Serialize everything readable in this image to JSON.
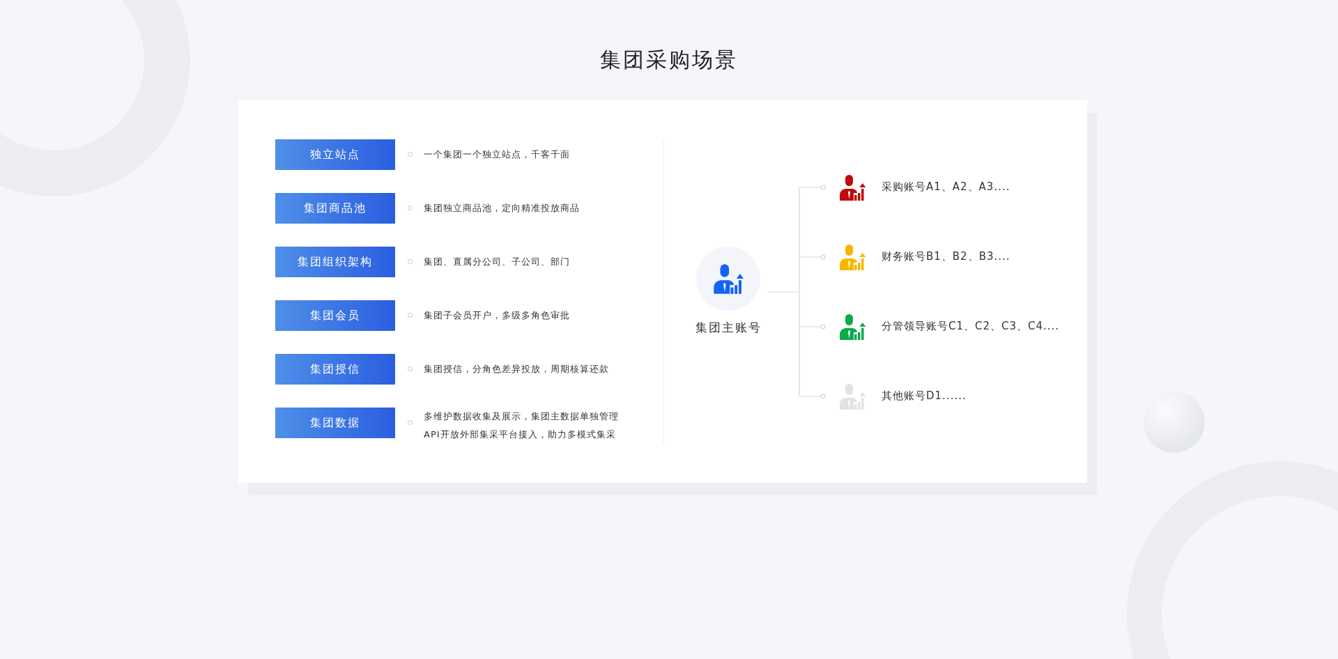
{
  "title": "集团采购场景",
  "features": [
    {
      "label": "独立站点",
      "description": [
        "一个集团一个独立站点，千客千面"
      ]
    },
    {
      "label": "集团商品池",
      "description": [
        "集团独立商品池，定向精准投放商品"
      ]
    },
    {
      "label": "集团组织架构",
      "description": [
        "集团、直属分公司、子公司、部门"
      ]
    },
    {
      "label": "集团会员",
      "description": [
        "集团子会员开户，多级多角色审批"
      ]
    },
    {
      "label": "集团授信",
      "description": [
        "集团授信，分角色差异投放，周期核算还款"
      ]
    },
    {
      "label": "集团数据",
      "description": [
        "多维护数据收集及展示，集团主数据单独管理",
        "API开放外部集采平台接入，助力多模式集采"
      ]
    }
  ],
  "main_account": {
    "label": "集团主账号",
    "color": "#1463f5"
  },
  "sub_accounts": [
    {
      "label": "采购账号A1、A2、A3....",
      "color": "#c20a0a"
    },
    {
      "label": "财务账号B1、B2、B3....",
      "color": "#f5b800"
    },
    {
      "label": "分管领导账号C1、C2、C3、C4....",
      "color": "#0aab4a"
    },
    {
      "label": "其他账号D1......",
      "color": "#e2e2e2"
    }
  ]
}
